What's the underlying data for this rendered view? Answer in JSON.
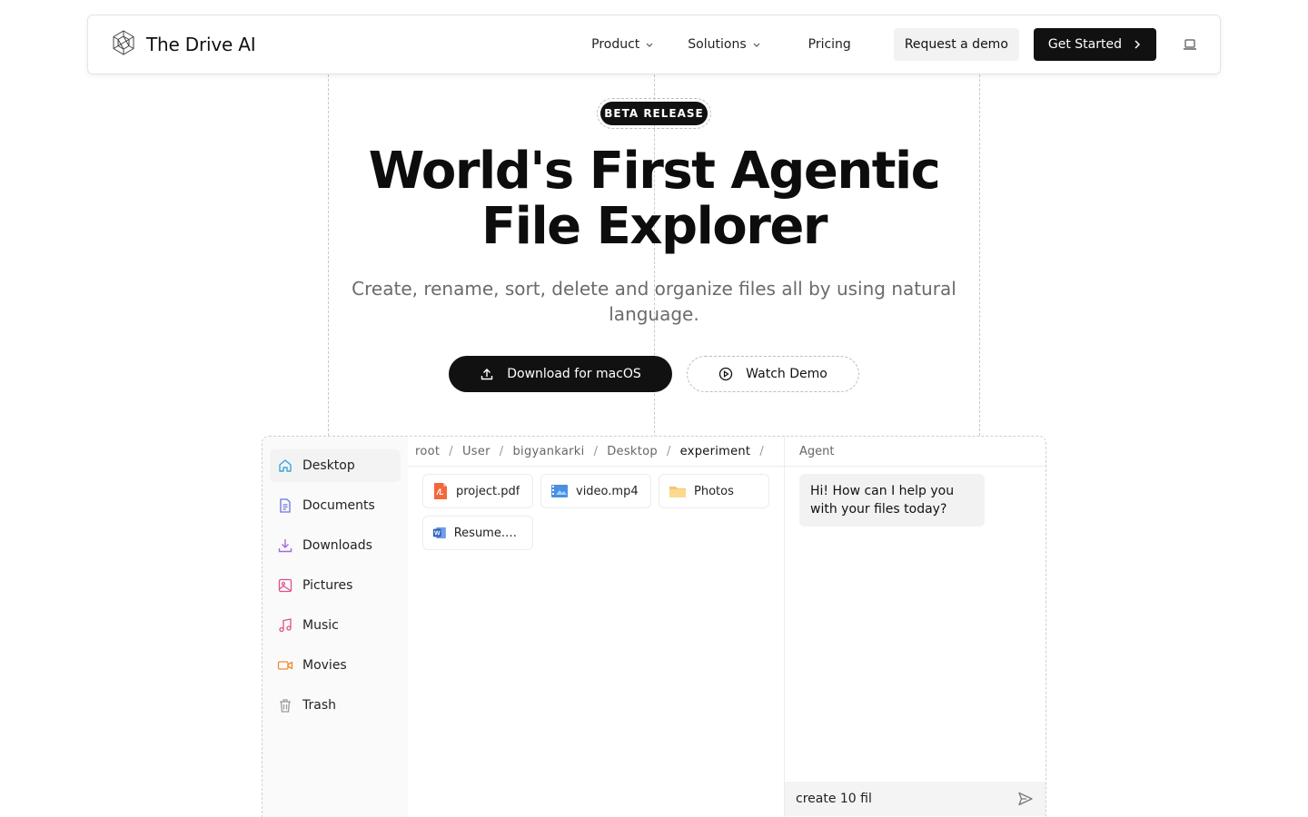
{
  "nav": {
    "brand": "The Drive AI",
    "links": [
      {
        "label": "Product",
        "has_dropdown": true
      },
      {
        "label": "Solutions",
        "has_dropdown": true
      },
      {
        "label": "Pricing",
        "has_dropdown": false
      }
    ],
    "demo_label": "Request a demo",
    "start_label": "Get Started"
  },
  "hero": {
    "badge": "BETA RELEASE",
    "title_line1": "World's First Agentic",
    "title_line2": "File Explorer",
    "subtitle": "Create, rename, sort, delete and organize files all by using natural language.",
    "download_label": "Download for macOS",
    "watch_label": "Watch Demo"
  },
  "explorer": {
    "sidebar": [
      {
        "label": "Desktop",
        "icon": "home-icon",
        "color": "#3aa6d6"
      },
      {
        "label": "Documents",
        "icon": "document-icon",
        "color": "#6b74d9"
      },
      {
        "label": "Downloads",
        "icon": "download-icon",
        "color": "#a36bd9"
      },
      {
        "label": "Pictures",
        "icon": "image-icon",
        "color": "#e0508c"
      },
      {
        "label": "Music",
        "icon": "music-icon",
        "color": "#e0508c"
      },
      {
        "label": "Movies",
        "icon": "video-icon",
        "color": "#f08a2c"
      },
      {
        "label": "Trash",
        "icon": "trash-icon",
        "color": "#9a9a9a"
      }
    ],
    "breadcrumb": [
      "root",
      "User",
      "bigyankarki",
      "Desktop",
      "experiment"
    ],
    "files": [
      {
        "name": "project.pdf",
        "icon": "pdf-icon"
      },
      {
        "name": "video.mp4",
        "icon": "video-file-icon"
      },
      {
        "name": "Photos",
        "icon": "folder-icon"
      },
      {
        "name": "Resume.docx",
        "icon": "word-icon"
      }
    ],
    "agent": {
      "title": "Agent",
      "message": "Hi! How can I help you with your files today?",
      "input_value": "create 10 fil"
    }
  }
}
